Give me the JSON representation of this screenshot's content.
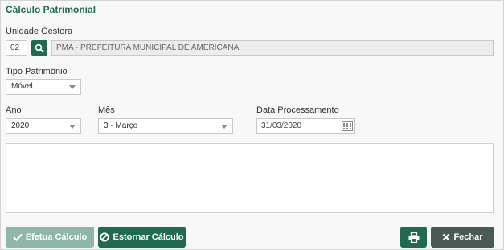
{
  "title": "Cálculo Patrimonial",
  "unidade": {
    "label": "Unidade Gestora",
    "code": "02",
    "name": "PMA - PREFEITURA MUNICIPAL DE AMERICANA"
  },
  "tipo": {
    "label": "Tipo Patrimônio",
    "value": "Móvel"
  },
  "ano": {
    "label": "Ano",
    "value": "2020"
  },
  "mes": {
    "label": "Mês",
    "value": "3 - Março"
  },
  "data_proc": {
    "label": "Data Processamento",
    "value": "31/03/2020"
  },
  "buttons": {
    "efetua": "Efetua Cálculo",
    "estornar": "Estornar Cálculo",
    "fechar": "Fechar"
  },
  "colors": {
    "primary": "#1e6b52",
    "disabled": "#8fb7a9",
    "dark": "#4a5a55"
  },
  "icons": {
    "search": "search-icon",
    "calendar": "calendar-icon",
    "check": "check-icon",
    "ban": "ban-icon",
    "print": "printer-icon",
    "close": "close-icon"
  }
}
